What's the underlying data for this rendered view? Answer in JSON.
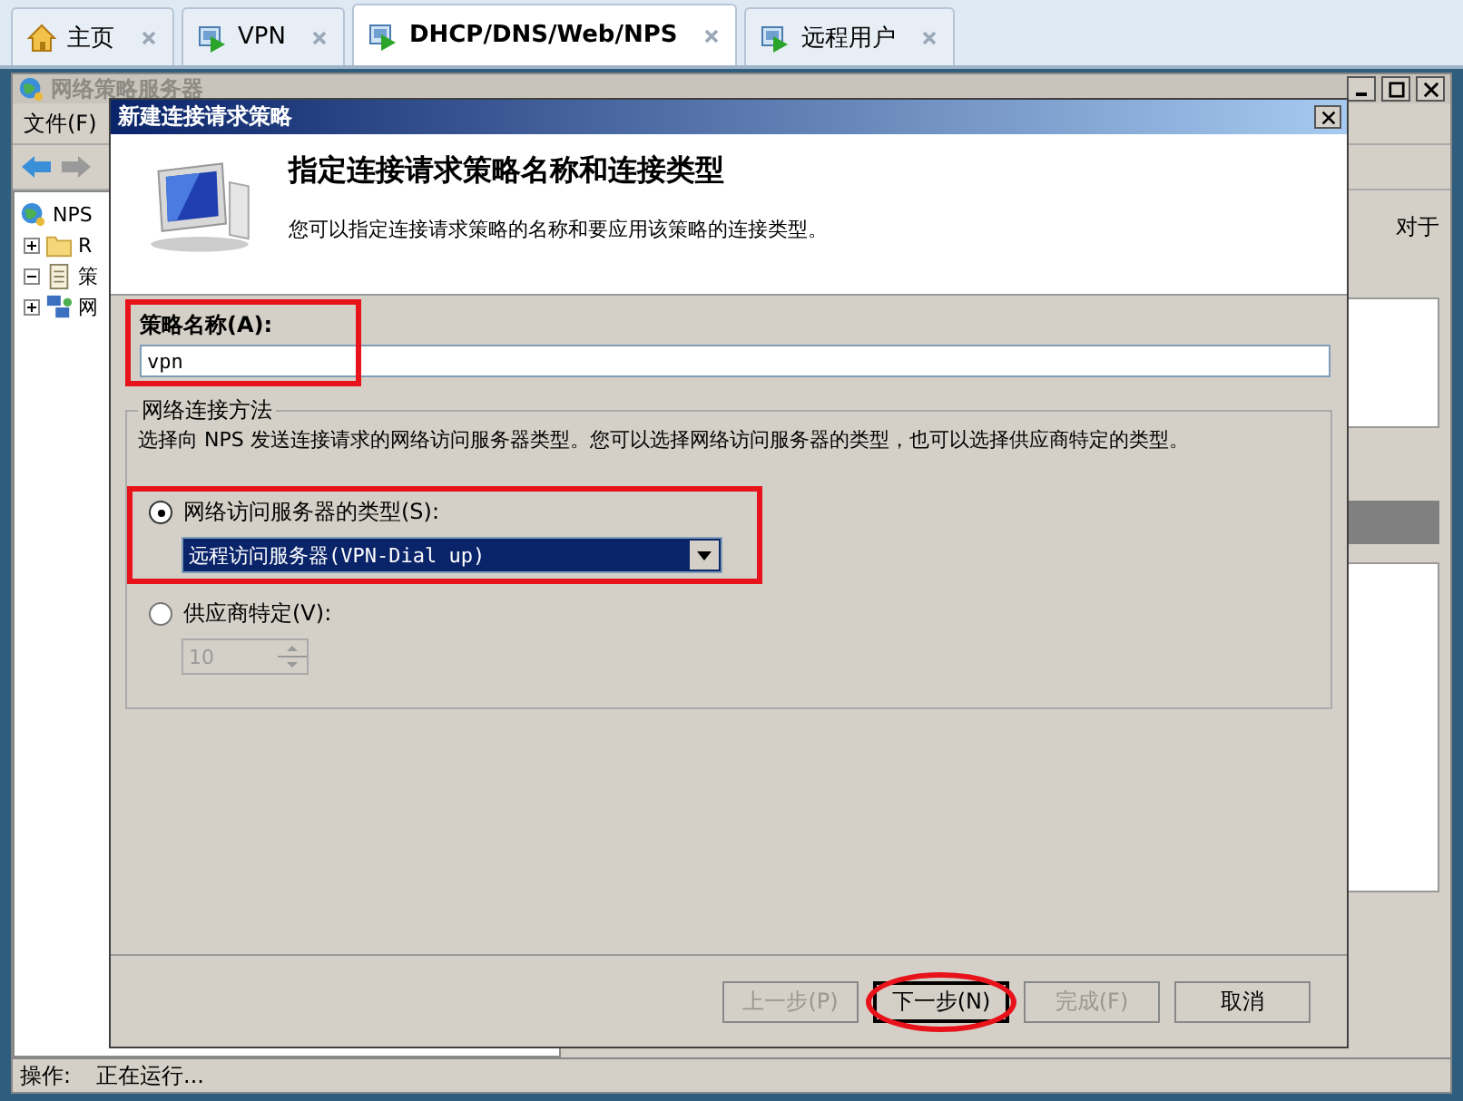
{
  "tabs": [
    {
      "label": "主页",
      "kind": "home",
      "selected": false
    },
    {
      "label": "VPN",
      "kind": "server",
      "selected": false
    },
    {
      "label": "DHCP/DNS/Web/NPS",
      "kind": "server",
      "selected": true
    },
    {
      "label": "远程用户",
      "kind": "server",
      "selected": false
    }
  ],
  "background_window": {
    "title": "网络策略服务器",
    "menu": [
      "文件(F)"
    ],
    "tree": [
      {
        "label": "NPS",
        "kind": "globe",
        "children": [
          {
            "label": "R",
            "kind": "folder",
            "expanded": false
          },
          {
            "label": "策",
            "kind": "policy",
            "expanded": true
          },
          {
            "label": "网",
            "kind": "network",
            "expanded": false
          }
        ]
      }
    ],
    "side_text": "对于",
    "status_label": "操作:",
    "status_value": "正在运行..."
  },
  "dialog": {
    "title": "新建连接请求策略",
    "heading": "指定连接请求策略名称和连接类型",
    "description": "您可以指定连接请求策略的名称和要应用该策略的连接类型。",
    "name_label": "策略名称(A):",
    "name_value": "vpn",
    "name_highlighted": true,
    "group_label": "网络连接方法",
    "group_description": "选择向 NPS 发送连接请求的网络访问服务器类型。您可以选择网络访问服务器的类型，也可以选择供应商特定的类型。",
    "options": [
      {
        "label": "网络访问服务器的类型(S):",
        "kind": "dropdown",
        "value": "远程访问服务器(VPN-Dial up)",
        "selected": true,
        "highlighted": true
      },
      {
        "label": "供应商特定(V):",
        "kind": "spinner",
        "value": "10",
        "selected": false
      }
    ],
    "buttons": [
      {
        "label": "上一步(P)",
        "disabled": true,
        "highlighted": false
      },
      {
        "label": "下一步(N)",
        "disabled": false,
        "highlighted": true
      },
      {
        "label": "完成(F)",
        "disabled": true,
        "highlighted": false
      },
      {
        "label": "取消",
        "disabled": false,
        "highlighted": false
      }
    ]
  }
}
